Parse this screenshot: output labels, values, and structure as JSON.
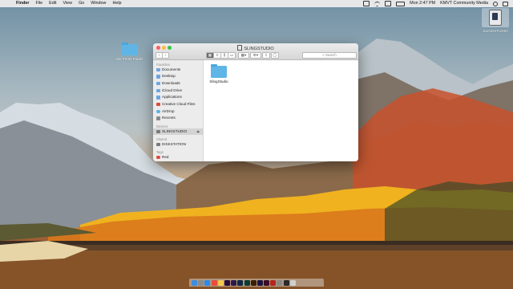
{
  "menubar": {
    "apple_glyph": "",
    "items": [
      "Finder",
      "File",
      "Edit",
      "View",
      "Go",
      "Window",
      "Help"
    ],
    "clock": "Mon 2:47 PM",
    "user": "KMVT Community Media"
  },
  "desktop": {
    "folder_label": "Ms Press Folder",
    "drive_label": "SLINGSTUDIO"
  },
  "finder": {
    "title": "SLINGSTUDIO",
    "search_placeholder": "Search",
    "sidebar": {
      "favorites_heading": "Favorites",
      "favorites": [
        {
          "label": "Documents",
          "icon": "documents-icon",
          "color": "#6ba6e0"
        },
        {
          "label": "Desktop",
          "icon": "desktop-icon",
          "color": "#6ba6e0"
        },
        {
          "label": "Downloads",
          "icon": "downloads-icon",
          "color": "#6ba6e0"
        },
        {
          "label": "iCloud Drive",
          "icon": "icloud-icon",
          "color": "#6ba6e0"
        },
        {
          "label": "Applications",
          "icon": "applications-icon",
          "color": "#6ba6e0"
        },
        {
          "label": "Creative Cloud Files",
          "icon": "creative-cloud-icon",
          "color": "#d94a3a"
        },
        {
          "label": "AirDrop",
          "icon": "airdrop-icon",
          "color": "#5cb0e8"
        },
        {
          "label": "Recents",
          "icon": "recents-icon",
          "color": "#8a8a8a"
        }
      ],
      "devices_heading": "Devices",
      "devices": [
        {
          "label": "SLINGSTUDIO",
          "icon": "drive-icon",
          "color": "#7a7a7a",
          "selected": true
        }
      ],
      "shared_heading": "Shared",
      "shared": [
        {
          "label": "DISKSTATION",
          "icon": "server-icon",
          "color": "#7a7a7a"
        }
      ],
      "tags_heading": "Tags",
      "tags": [
        {
          "label": "Red",
          "icon": "red-tag-icon",
          "color": "#e0463c"
        }
      ]
    },
    "items": [
      {
        "label": "SlingStudio",
        "icon": "folder-icon"
      }
    ]
  },
  "dock": {
    "apps": [
      {
        "name": "finder-app",
        "color": "#3d8de0"
      },
      {
        "name": "launchpad-app",
        "color": "#8b8b8b"
      },
      {
        "name": "safari-app",
        "color": "#2c8be8"
      },
      {
        "name": "chrome-app",
        "color": "#e94b3c"
      },
      {
        "name": "photos-app",
        "color": "#f2c94c"
      },
      {
        "name": "premiere-app",
        "color": "#2a0a3a"
      },
      {
        "name": "aftereffects-app",
        "color": "#2b1b4a"
      },
      {
        "name": "photoshop-app",
        "color": "#0f2a44"
      },
      {
        "name": "audition-app",
        "color": "#0c3b34"
      },
      {
        "name": "illustrator-app",
        "color": "#3a1f05"
      },
      {
        "name": "mediaencoder-app",
        "color": "#1d1340"
      },
      {
        "name": "indesign-app",
        "color": "#3b0d22"
      },
      {
        "name": "acrobat-app",
        "color": "#b3261e"
      },
      {
        "name": "systemprefs-app",
        "color": "#888888"
      },
      {
        "name": "slingstudio-app",
        "color": "#2a2a2a"
      },
      {
        "name": "trash-app",
        "color": "#cfcfcf"
      }
    ]
  }
}
